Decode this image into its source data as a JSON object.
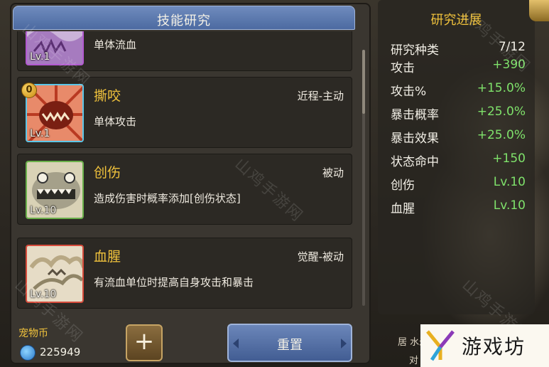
{
  "header": {
    "title": "技能研究"
  },
  "skills": [
    {
      "name": "",
      "type": "",
      "desc": "单体流血",
      "level": "Lv.1",
      "icon": "purple-beast-icon"
    },
    {
      "name": "撕咬",
      "type": "近程-主动",
      "desc": "单体攻击",
      "level": "Lv.1",
      "cost": "0",
      "icon": "red-fang-icon"
    },
    {
      "name": "创伤",
      "type": "被动",
      "desc": "造成伤害时概率添加[创伤状态]",
      "level": "Lv.10",
      "icon": "green-beast-jaw-icon"
    },
    {
      "name": "血腥",
      "type": "觉醒-被动",
      "desc": "有流血单位时提高自身攻击和暴击",
      "level": "Lv.10",
      "icon": "red-dragon-icon"
    }
  ],
  "currency": {
    "label": "宠物币",
    "value": "225949",
    "icon": "blue-paw-coin-icon"
  },
  "buttons": {
    "plus": "+",
    "reset": "重置"
  },
  "progress": {
    "title": "研究进展",
    "rows": [
      {
        "key": "研究种类",
        "value": "7/12",
        "color": "white"
      },
      {
        "key": "攻击",
        "value": "+390",
        "color": "green"
      },
      {
        "key": "攻击%",
        "value": "+15.0%",
        "color": "green"
      },
      {
        "key": "暴击概率",
        "value": "+25.0%",
        "color": "green"
      },
      {
        "key": "暴击效果",
        "value": "+25.0%",
        "color": "green"
      },
      {
        "key": "状态命中",
        "value": "+150",
        "color": "green"
      },
      {
        "key": "创伤",
        "value": "Lv.10",
        "color": "green"
      },
      {
        "key": "血腥",
        "value": "Lv.10",
        "color": "green"
      }
    ]
  },
  "footer": {
    "line1": "居      水米",
    "line2": "对   所有宠物生效"
  },
  "brand": {
    "text": "游戏坊"
  },
  "watermark": "山鸡手游网",
  "colors": {
    "accent_gold": "#f0c23c",
    "stat_green": "#7fe26b",
    "header_blue": "#4c6aa1"
  }
}
